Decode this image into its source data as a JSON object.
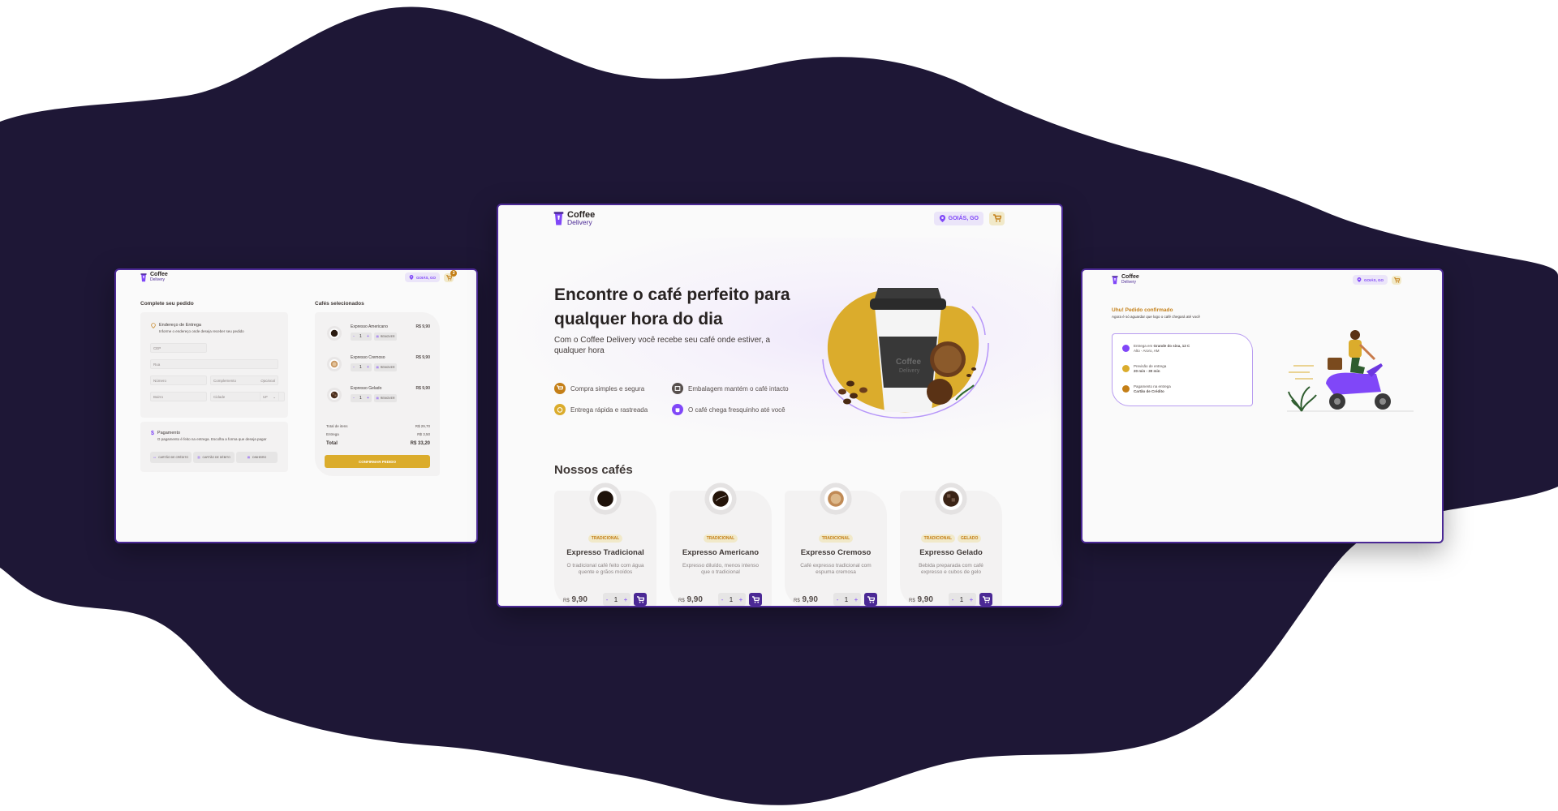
{
  "colors": {
    "background_blob": "#1e1736",
    "purple_dark": "#4b2995",
    "purple": "#8047f8",
    "purple_light": "#ebe5f9",
    "yellow_dark": "#c47f17",
    "yellow": "#dbac2c",
    "yellow_light": "#f1e9c9",
    "base_background": "#fafafa"
  },
  "brand": {
    "name": "Coffee",
    "sub": "Delivery",
    "logo_icon": "coffee-cup-icon"
  },
  "location": {
    "label": "GOIÁS, GO",
    "icon": "map-pin-icon"
  },
  "cart": {
    "icon": "shopping-cart-icon",
    "count": "3"
  },
  "checkout": {
    "title": "Complete seu pedido",
    "address": {
      "title": "Endereço de Entrega",
      "subtitle": "Informe o endereço onde deseja receber seu pedido",
      "icon": "map-pin-line-icon",
      "fields": {
        "cep": "CEP",
        "rua": "Rua",
        "numero": "Número",
        "complemento": "Complemento",
        "complemento_hint": "Opcional",
        "bairro": "Bairro",
        "cidade": "Cidade",
        "uf": "UF"
      }
    },
    "payment": {
      "title": "Pagamento",
      "subtitle": "O pagamento é feito na entrega. Escolha a forma que deseja pagar",
      "icon": "currency-dollar-icon",
      "options": [
        "CARTÃO DE CRÉDITO",
        "CARTÃO DE DÉBITO",
        "DINHEIRO"
      ]
    },
    "selected_title": "Cafés selecionados",
    "items": [
      {
        "name": "Expresso Americano",
        "price": "R$ 9,90",
        "qty": "1",
        "remove": "REMOVER"
      },
      {
        "name": "Expresso Cremoso",
        "price": "R$ 9,90",
        "qty": "1",
        "remove": "REMOVER"
      },
      {
        "name": "Expresso Gelado",
        "price": "R$ 9,90",
        "qty": "1",
        "remove": "REMOVER"
      }
    ],
    "summary": {
      "items_label": "Total de itens",
      "items_value": "R$ 29,70",
      "delivery_label": "Entrega",
      "delivery_value": "R$ 3,50",
      "total_label": "Total",
      "total_value": "R$ 33,20"
    },
    "confirm": "CONFIRMAR PEDIDO"
  },
  "home": {
    "hero_title": "Encontre o café perfeito para qualquer hora do dia",
    "hero_subtitle": "Com o Coffee Delivery você recebe seu café onde estiver, a qualquer hora",
    "features": [
      {
        "label": "Compra simples e segura",
        "icon": "shopping-cart-icon",
        "color": "#c47f17"
      },
      {
        "label": "Embalagem mantém o café intacto",
        "icon": "package-icon",
        "color": "#574f4d"
      },
      {
        "label": "Entrega rápida e rastreada",
        "icon": "timer-icon",
        "color": "#dbac2c"
      },
      {
        "label": "O café chega fresquinho até você",
        "icon": "coffee-icon",
        "color": "#8047f8"
      }
    ],
    "section_title": "Nossos cafés",
    "coffees": [
      {
        "name": "Expresso Tradicional",
        "tags": [
          "TRADICIONAL"
        ],
        "description": "O tradicional café feito com água quente e grãos moídos",
        "currency": "R$",
        "price": "9,90",
        "qty": "1",
        "cup": "espresso"
      },
      {
        "name": "Expresso Americano",
        "tags": [
          "TRADICIONAL"
        ],
        "description": "Expresso diluído, menos intenso que o tradicional",
        "currency": "R$",
        "price": "9,90",
        "qty": "1",
        "cup": "americano"
      },
      {
        "name": "Expresso Cremoso",
        "tags": [
          "TRADICIONAL"
        ],
        "description": "Café expresso tradicional com espuma cremosa",
        "currency": "R$",
        "price": "9,90",
        "qty": "1",
        "cup": "cremoso"
      },
      {
        "name": "Expresso Gelado",
        "tags": [
          "TRADICIONAL",
          "GELADO"
        ],
        "description": "Bebida preparada com café expresso e cubos de gelo",
        "currency": "R$",
        "price": "9,90",
        "qty": "1",
        "cup": "gelado"
      }
    ]
  },
  "success": {
    "title": "Uhu! Pedido confirmado",
    "subtitle": "Agora é só aguardar que logo o café chegará até você",
    "rows": [
      {
        "line1_prefix": "Entrega em ",
        "line1_bold": "Grande do sina, 12 C",
        "line2": "Alto - Aroro, AM",
        "color": "#8047f8",
        "icon": "map-pin-icon"
      },
      {
        "line1_prefix": "Previsão de entrega",
        "line1_bold": "",
        "line2": "20 min - 30 min",
        "color": "#dbac2c",
        "icon": "timer-icon"
      },
      {
        "line1_prefix": "Pagamento na entrega",
        "line1_bold": "",
        "line2": "Cartão de Crédito",
        "color": "#c47f17",
        "icon": "currency-dollar-icon"
      }
    ],
    "illustration": "delivery-scooter-illustration"
  }
}
